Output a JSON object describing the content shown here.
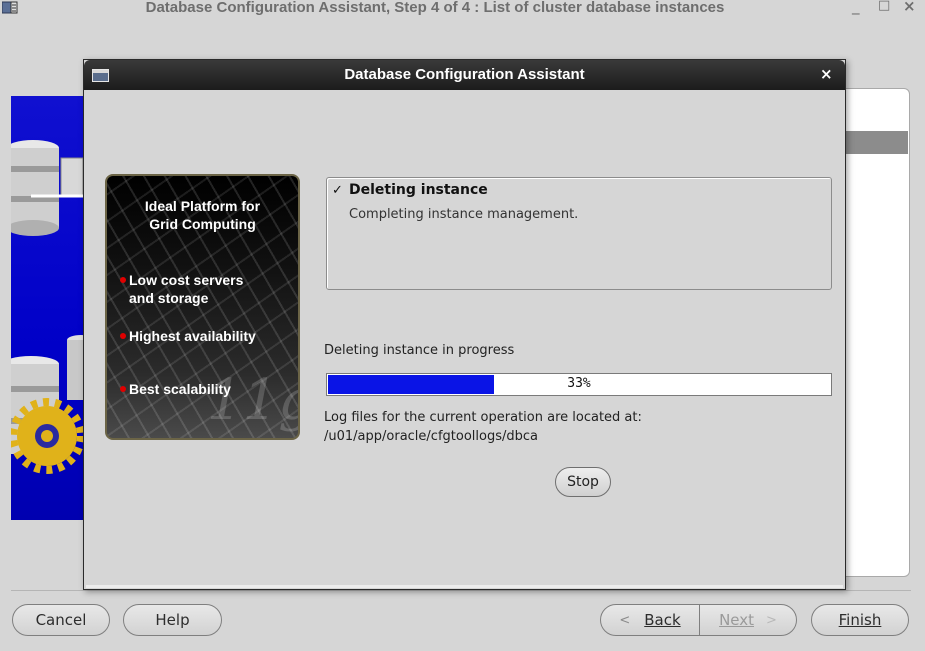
{
  "window": {
    "title": "Database Configuration Assistant, Step 4 of 4 : List of cluster database instances",
    "controls": {
      "minimize": "_",
      "maximize": "□",
      "close": "×"
    },
    "icon": "app-icon"
  },
  "footer": {
    "cancel_label": "Cancel",
    "help_label": "Help",
    "back_label": "Back",
    "next_label": "Next",
    "finish_label": "Finish",
    "back_arrow": "<",
    "next_arrow": ">"
  },
  "dialog": {
    "title": "Database Configuration Assistant",
    "close": "×",
    "promo": {
      "headline": "Ideal Platform for\nGrid Computing",
      "bullets": [
        "Low cost servers\nand storage",
        "Highest availability",
        "Best scalability"
      ],
      "mark": "11g"
    },
    "status": {
      "check": "✓",
      "heading": "Deleting instance",
      "detail": "Completing instance management."
    },
    "progress": {
      "label": "Deleting instance in progress",
      "percent": 33,
      "text": "33%",
      "fill_color": "#0a14e6"
    },
    "log": {
      "line1": "Log files for the current operation are located at:",
      "line2": "/u01/app/oracle/cfgtoollogs/dbca"
    },
    "stop_label": "Stop"
  }
}
